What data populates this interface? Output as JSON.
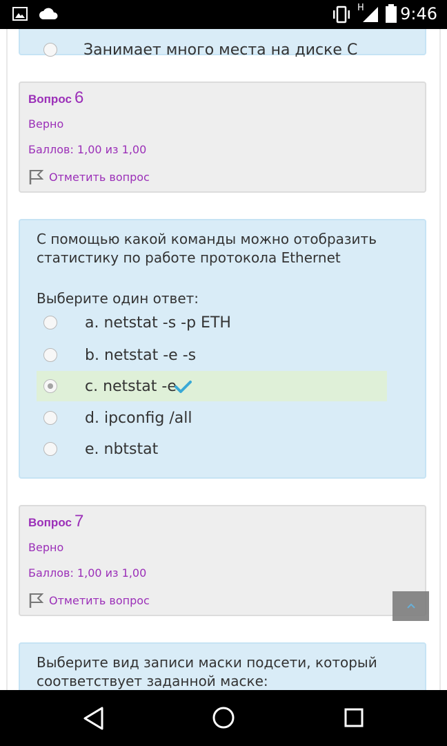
{
  "status_bar": {
    "time": "9:46",
    "network_type": "H"
  },
  "prev_card": {
    "partial_text": "Занимает много места на диске С"
  },
  "q6": {
    "label": "Вопрос",
    "number": "6",
    "state": "Верно",
    "grade": "Баллов: 1,00 из 1,00",
    "flag_label": "Отметить вопрос",
    "question_line1": "С помощью какой команды можно отобразить",
    "question_line2": "статистику по работе протокола Ethernet",
    "prompt": "Выберите один ответ:",
    "options": [
      {
        "label": "a. netstat -s -p ETH",
        "selected": false,
        "correct": false
      },
      {
        "label": "b. netstat -e -s",
        "selected": false,
        "correct": false
      },
      {
        "label": "c. netstat -e",
        "selected": true,
        "correct": true
      },
      {
        "label": "d. ipconfig /all",
        "selected": false,
        "correct": false
      },
      {
        "label": "e. nbtstat",
        "selected": false,
        "correct": false
      }
    ]
  },
  "q7": {
    "label": "Вопрос",
    "number": "7",
    "state": "Верно",
    "grade": "Баллов: 1,00 из 1,00",
    "flag_label": "Отметить вопрос",
    "question_line1": "Выберите вид записи маски подсети, который",
    "question_line2": "соответствует заданной маске:"
  },
  "colors": {
    "accent": "#9b2fb8",
    "info_bg": "#eeeeee",
    "question_bg": "#d9ecf7",
    "correct_bg": "#dff0d8",
    "check": "#39a9d6"
  },
  "icons": {
    "status": [
      "image-icon",
      "cloud-icon",
      "vibrate-icon",
      "signal-icon",
      "battery-icon"
    ],
    "flag": "flag-icon",
    "check": "check-icon",
    "back_to_top": "chevron-up-icon",
    "nav": [
      "back-icon",
      "home-icon",
      "recents-icon"
    ]
  }
}
